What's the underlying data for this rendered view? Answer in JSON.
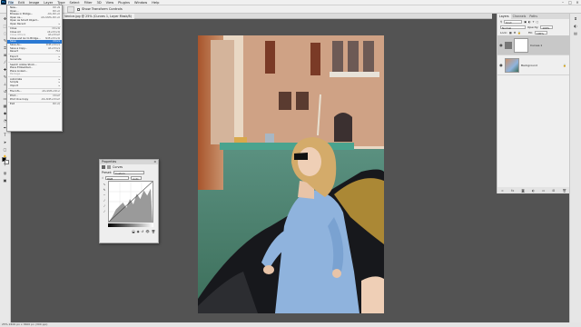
{
  "menubar": {
    "items": [
      "File",
      "Edit",
      "Image",
      "Layer",
      "Type",
      "Select",
      "Filter",
      "3D",
      "View",
      "Plugins",
      "Window",
      "Help"
    ],
    "active": "File"
  },
  "optionsbar": {
    "checkbox_label": "Show Transform Controls"
  },
  "document": {
    "tab_label": "Venice.jpg @ 25% (Curves 1, Layer Mask/8)"
  },
  "file_menu": {
    "items": [
      {
        "label": "New...",
        "shortcut": "Ctrl+N"
      },
      {
        "label": "Open...",
        "shortcut": "Ctrl+O"
      },
      {
        "label": "Browse in Bridge...",
        "shortcut": "Alt+Ctrl+O"
      },
      {
        "label": "Open As...",
        "shortcut": "Alt+Shift+Ctrl+O"
      },
      {
        "label": "Open as Smart Object...",
        "shortcut": ""
      },
      {
        "label": "Open Recent",
        "shortcut": "▸"
      },
      {
        "sep": true
      },
      {
        "label": "Close",
        "shortcut": "Ctrl+W"
      },
      {
        "label": "Close All",
        "shortcut": "Alt+Ctrl+W"
      },
      {
        "label": "Close Others",
        "shortcut": "Alt+Ctrl+P",
        "disabled": true
      },
      {
        "label": "Close and Go to Bridge...",
        "shortcut": "Shift+Ctrl+W"
      },
      {
        "label": "Save",
        "shortcut": "Ctrl+S",
        "highlight": true
      },
      {
        "label": "Save As...",
        "shortcut": "Shift+Ctrl+S"
      },
      {
        "label": "Save a Copy...",
        "shortcut": "Alt+Ctrl+S"
      },
      {
        "label": "Revert",
        "shortcut": "F12"
      },
      {
        "sep": true
      },
      {
        "label": "Export",
        "shortcut": "▸"
      },
      {
        "label": "Generate",
        "shortcut": "▸"
      },
      {
        "sep": true
      },
      {
        "label": "Search Adobe Stock...",
        "shortcut": ""
      },
      {
        "label": "Place Embedded...",
        "shortcut": ""
      },
      {
        "label": "Place Linked...",
        "shortcut": ""
      },
      {
        "label": "Package...",
        "shortcut": "",
        "disabled": true
      },
      {
        "sep": true
      },
      {
        "label": "Automate",
        "shortcut": "▸"
      },
      {
        "label": "Scripts",
        "shortcut": "▸"
      },
      {
        "label": "Import",
        "shortcut": "▸"
      },
      {
        "sep": true
      },
      {
        "label": "File Info...",
        "shortcut": "Alt+Shift+Ctrl+I"
      },
      {
        "sep": true
      },
      {
        "label": "Print...",
        "shortcut": "Ctrl+P"
      },
      {
        "label": "Print One Copy",
        "shortcut": "Alt+Shift+Ctrl+P"
      },
      {
        "sep": true
      },
      {
        "label": "Exit",
        "shortcut": "Ctrl+Q"
      }
    ]
  },
  "properties": {
    "title": "Properties",
    "adjustment": "Curves",
    "preset_label": "Preset:",
    "preset_value": "Custom",
    "channel_value": "RGB",
    "auto_label": "Auto"
  },
  "layers": {
    "tabs": [
      "Layers",
      "Channels",
      "Paths"
    ],
    "kind_label": "Kind",
    "blend_mode": "Normal",
    "opacity_label": "Opacity:",
    "opacity_value": "100%",
    "lock_label": "Lock:",
    "fill_label": "Fill:",
    "fill_value": "100%",
    "items": [
      {
        "name": "Curves 1",
        "selected": true
      },
      {
        "name": "Background",
        "selected": false
      }
    ]
  },
  "statusbar": {
    "text": "25%    2400 px x 3600 px (300 ppi)"
  },
  "colors": {
    "accent": "#2b79d3",
    "workspace": "#535353",
    "panel": "#efefef"
  }
}
